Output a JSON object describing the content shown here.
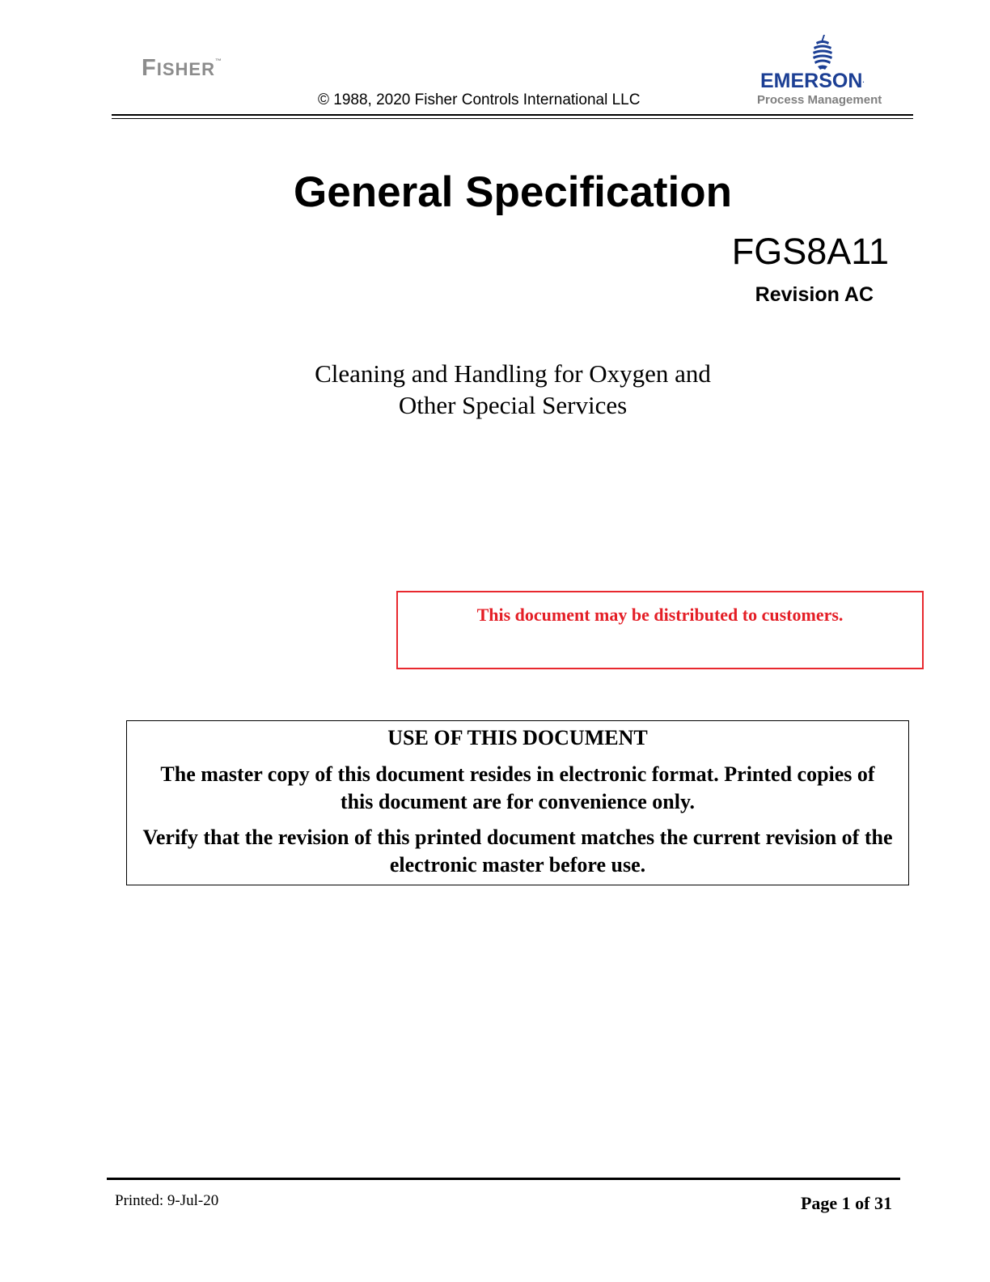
{
  "header": {
    "fisher_logo": {
      "first_letter": "F",
      "rest": "ISHER",
      "trademark": "™"
    },
    "copyright": "© 1988, 2020 Fisher Controls International LLC",
    "emerson_logo": {
      "name": "EMERSON",
      "trademark": ".",
      "subtitle": "Process Management",
      "brand_color": "#1c3f94",
      "icon": "emerson-globe-icon"
    }
  },
  "title_block": {
    "title": "General Specification",
    "doc_number": "FGS8A11",
    "revision": "Revision AC",
    "subtitle_line1": "Cleaning and Handling for Oxygen and",
    "subtitle_line2": "Other Special Services"
  },
  "distribution_notice": {
    "text": "This document may be distributed to customers.",
    "color": "#e41e26"
  },
  "use_notice": {
    "heading": "USE OF THIS DOCUMENT",
    "paragraph1": "The master copy of this document resides in electronic format.  Printed copies of this document are for convenience only.",
    "paragraph2": "Verify that the revision of this printed document matches the current revision of the electronic master before use."
  },
  "footer": {
    "printed": "Printed: 9-Jul-20",
    "page": "Page 1 of 31"
  }
}
